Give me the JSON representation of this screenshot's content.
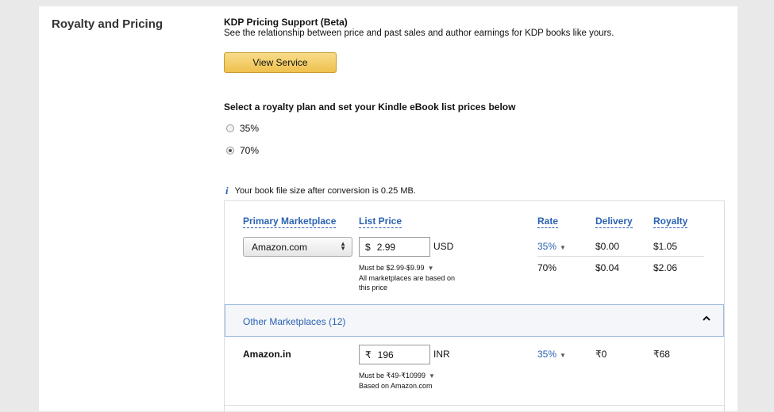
{
  "section_title": "Royalty and Pricing",
  "pricing_support": {
    "title": "KDP Pricing Support (Beta)",
    "description": "See the relationship between price and past sales and author earnings for KDP books like yours.",
    "button_label": "View Service"
  },
  "royalty_plan": {
    "heading": "Select a royalty plan and set your Kindle eBook list prices below",
    "options": [
      {
        "label": "35%",
        "selected": false
      },
      {
        "label": "70%",
        "selected": true
      }
    ]
  },
  "file_size_info": "Your book file size after conversion is 0.25 MB.",
  "table": {
    "headers": {
      "marketplace": "Primary Marketplace",
      "list_price": "List Price",
      "rate": "Rate",
      "delivery": "Delivery",
      "royalty": "Royalty"
    },
    "primary": {
      "marketplace": "Amazon.com",
      "currency_symbol": "$",
      "price": "2.99",
      "currency": "USD",
      "price_range": "Must be $2.99-$9.99",
      "note_line1": "All marketplaces are based on",
      "note_line2": "this price",
      "rows": [
        {
          "rate": "35%",
          "delivery": "$0.00",
          "royalty": "$1.05"
        },
        {
          "rate": "70%",
          "delivery": "$0.04",
          "royalty": "$2.06"
        }
      ]
    },
    "other_marketplaces_label": "Other Marketplaces (12)",
    "other": [
      {
        "marketplace": "Amazon.in",
        "currency_symbol": "₹",
        "price": "196",
        "currency": "INR",
        "price_range": "Must be ₹49-₹10999",
        "note": "Based on Amazon.com",
        "rate": "35%",
        "delivery": "₹0",
        "royalty": "₹68"
      }
    ]
  },
  "colors": {
    "link": "#2a62b3",
    "button": "#efc14e",
    "background": "#e9e9e9"
  }
}
